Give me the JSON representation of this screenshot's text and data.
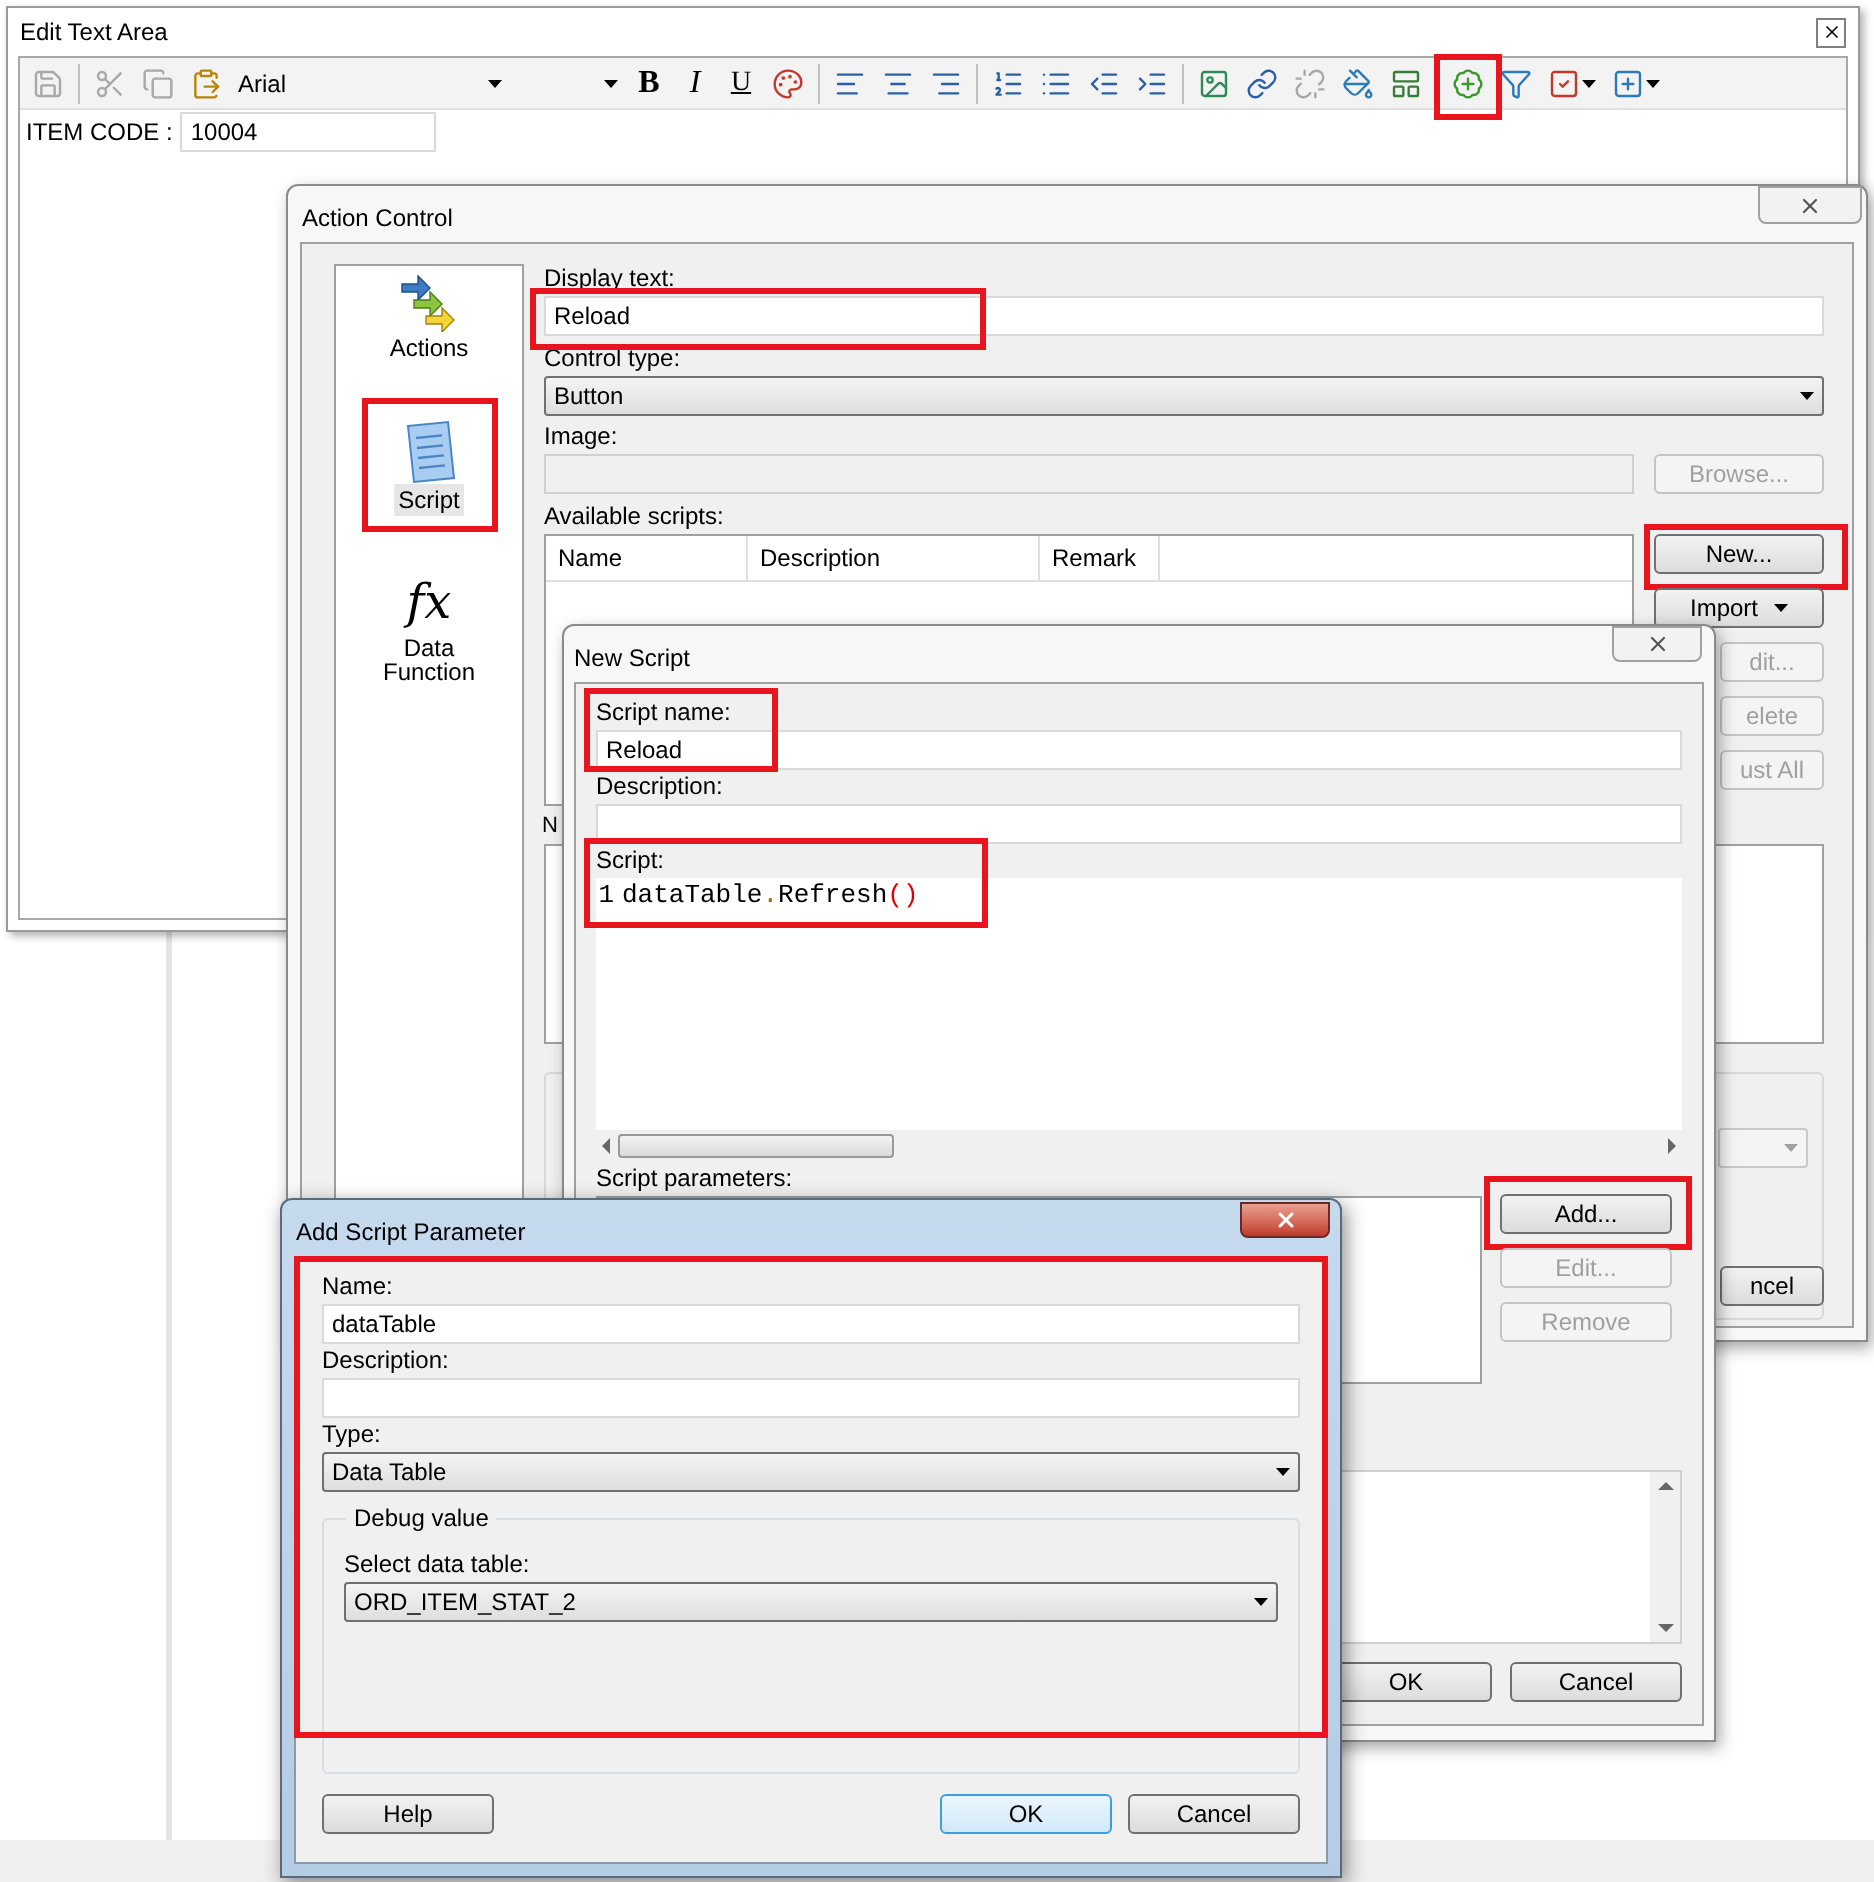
{
  "edit_text_area": {
    "title": "Edit Text Area",
    "toolbar": [
      {
        "kind": "icon",
        "disabled": true,
        "highlighted": false,
        "menu": false
      },
      {
        "kind": "separator"
      },
      {
        "kind": "icon",
        "disabled": true,
        "highlighted": false,
        "menu": false
      },
      {
        "kind": "icon",
        "disabled": true,
        "highlighted": false,
        "menu": false
      },
      {
        "kind": "icon",
        "disabled": false,
        "highlighted": false,
        "menu": false
      },
      {
        "kind": "select",
        "value": "Arial"
      },
      {
        "kind": "select"
      },
      {
        "kind": "text",
        "label": "B"
      },
      {
        "kind": "text",
        "label": "I"
      },
      {
        "kind": "text",
        "label": "U"
      },
      {
        "kind": "icon",
        "disabled": false,
        "highlighted": false,
        "menu": false
      },
      {
        "kind": "separator"
      },
      {
        "kind": "icon",
        "disabled": false,
        "highlighted": false,
        "menu": false
      },
      {
        "kind": "icon",
        "disabled": false,
        "highlighted": false,
        "menu": false
      },
      {
        "kind": "icon",
        "disabled": false,
        "highlighted": false,
        "menu": false
      },
      {
        "kind": "separator"
      },
      {
        "kind": "icon",
        "disabled": false,
        "highlighted": false,
        "menu": false
      },
      {
        "kind": "icon",
        "disabled": false,
        "highlighted": false,
        "menu": false
      },
      {
        "kind": "icon",
        "disabled": false,
        "highlighted": false,
        "menu": false
      },
      {
        "kind": "icon",
        "disabled": false,
        "highlighted": false,
        "menu": false
      },
      {
        "kind": "separator"
      },
      {
        "kind": "icon",
        "disabled": false,
        "highlighted": false,
        "menu": false
      },
      {
        "kind": "icon",
        "disabled": false,
        "highlighted": false,
        "menu": false
      },
      {
        "kind": "icon",
        "disabled": true,
        "highlighted": false,
        "menu": false
      },
      {
        "kind": "icon",
        "disabled": false,
        "highlighted": false,
        "menu": false
      },
      {
        "kind": "icon",
        "disabled": false,
        "highlighted": false,
        "menu": false
      },
      {
        "kind": "separator"
      },
      {
        "kind": "icon",
        "disabled": false,
        "highlighted": true,
        "menu": false
      },
      {
        "kind": "icon",
        "disabled": false,
        "highlighted": false,
        "menu": false
      },
      {
        "kind": "icon",
        "disabled": false,
        "highlighted": false,
        "menu": true
      },
      {
        "kind": "icon",
        "disabled": false,
        "highlighted": false,
        "menu": true
      }
    ],
    "field": {
      "label": "ITEM CODE :",
      "value": "10004"
    }
  },
  "action_control": {
    "title": "Action Control",
    "nav": [
      {
        "kind": "arrows",
        "label": "Actions",
        "selected": false,
        "highlighted": false
      },
      {
        "kind": "document",
        "label": "Script",
        "selected": true,
        "highlighted": true
      },
      {
        "kind": "formula",
        "glyph": "fx",
        "label": "Data Function",
        "selected": false,
        "highlighted": false
      }
    ],
    "display_text": {
      "label": "Display text:",
      "value": "Reload",
      "highlighted": true
    },
    "control_type": {
      "label": "Control type:",
      "value": "Button"
    },
    "image": {
      "label": "Image:",
      "disabled": true
    },
    "browse_button": {
      "label": "Browse...",
      "disabled": true
    },
    "available_scripts": {
      "label": "Available scripts:",
      "columns": [
        "Name",
        "Description",
        "Remark"
      ]
    },
    "side_buttons": [
      {
        "label": "New...",
        "disabled": false,
        "menu": false,
        "highlighted": true
      },
      {
        "label": "Import",
        "disabled": false,
        "menu": true,
        "highlighted": false
      },
      {
        "label": "dit...",
        "disabled": true,
        "menu": false,
        "highlighted": false
      },
      {
        "label": "elete",
        "disabled": true,
        "menu": false,
        "highlighted": false
      },
      {
        "label": "ust All",
        "disabled": true,
        "menu": false,
        "highlighted": false
      }
    ],
    "list_label": "N",
    "cancel_button": {
      "label": "ncel"
    }
  },
  "new_script": {
    "title": "New Script",
    "script_name": {
      "label": "Script name:",
      "value": "Reload",
      "highlighted": true
    },
    "description": {
      "label": "Description:"
    },
    "script": {
      "label": "Script:",
      "highlighted": true,
      "lines": [
        {
          "number": "1",
          "tokens": [
            {
              "text": "dataTable",
              "kind": "identifier"
            },
            {
              "text": ".",
              "kind": "operator"
            },
            {
              "text": "Refresh",
              "kind": "identifier"
            },
            {
              "text": "()",
              "kind": "paren"
            }
          ]
        }
      ]
    },
    "parameters": {
      "label": "Script parameters:"
    },
    "param_buttons": [
      {
        "label": "Add...",
        "disabled": false,
        "highlighted": true
      },
      {
        "label": "Edit...",
        "disabled": true,
        "highlighted": false
      },
      {
        "label": "Remove",
        "disabled": true,
        "highlighted": false
      }
    ],
    "buttons": [
      {
        "label": "OK"
      },
      {
        "label": "Cancel"
      }
    ]
  },
  "add_parameter": {
    "title": "Add Script Parameter",
    "highlighted": true,
    "name": {
      "label": "Name:",
      "value": "dataTable"
    },
    "description": {
      "label": "Description:"
    },
    "type": {
      "label": "Type:",
      "value": "Data Table"
    },
    "debug": {
      "legend": "Debug value",
      "label": "Select data table:",
      "value": "ORD_ITEM_STAT_2"
    },
    "buttons": [
      {
        "label": "Help",
        "default": false
      },
      {
        "label": "OK",
        "default": true
      },
      {
        "label": "Cancel",
        "default": false
      }
    ]
  }
}
